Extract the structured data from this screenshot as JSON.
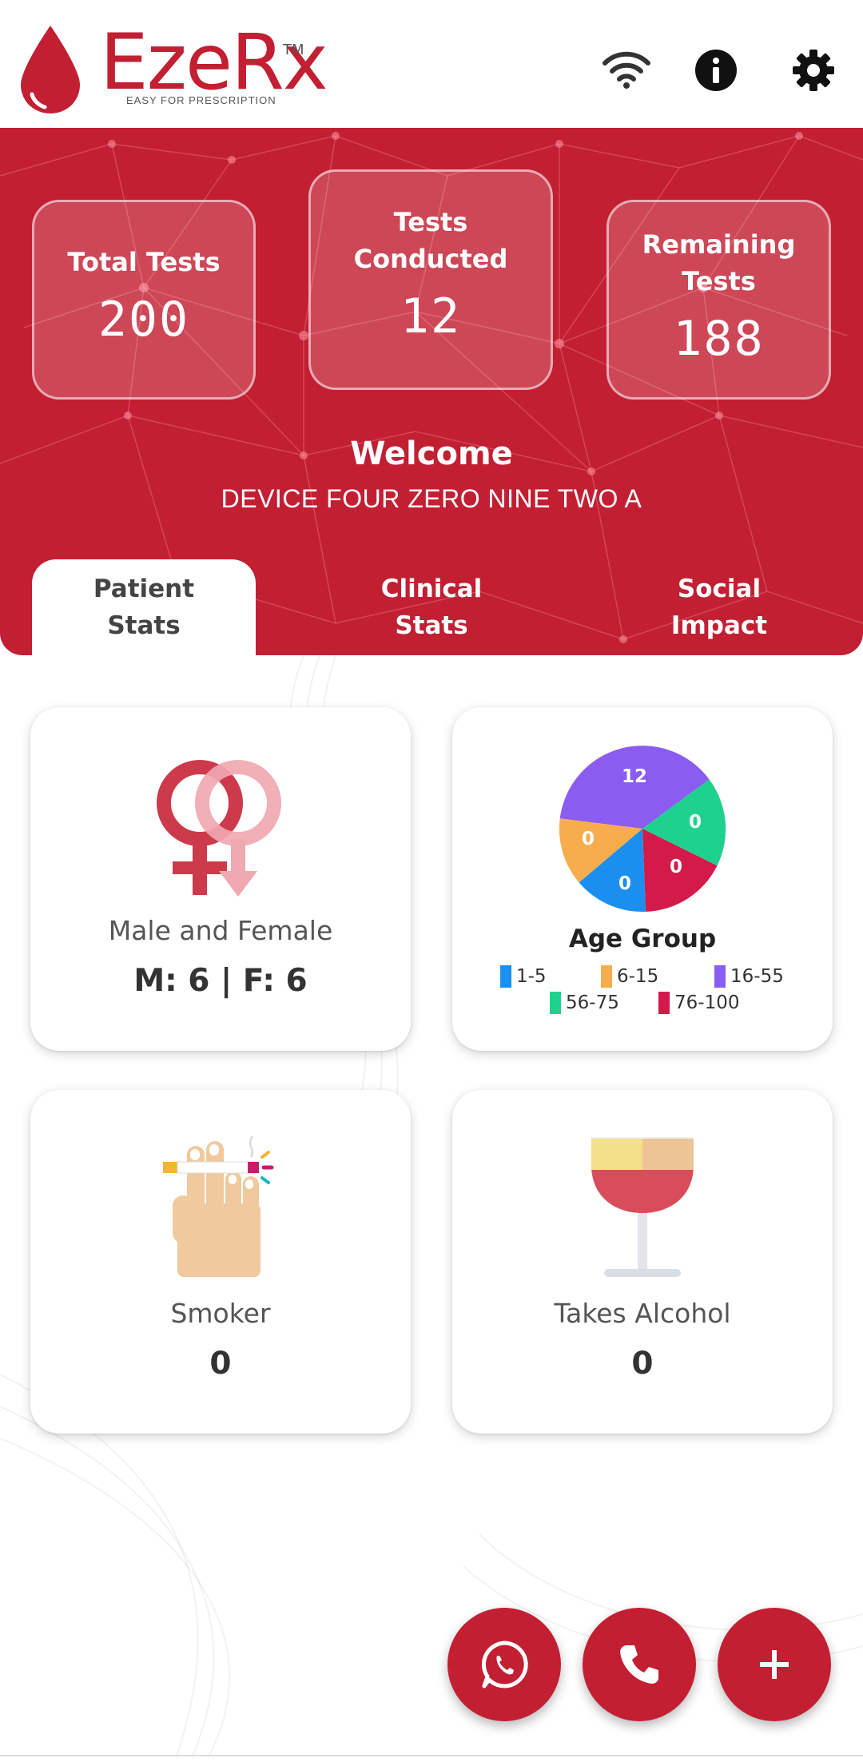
{
  "app": {
    "logo_text": "EzeRx",
    "logo_tm": "TM",
    "tagline": "EASY FOR PRESCRIPTION",
    "brand_color": "#c21f33"
  },
  "header_icons": [
    "wifi-icon",
    "info-icon",
    "settings-gear-icon"
  ],
  "stats": {
    "total": {
      "label": "Total Tests",
      "value": "200"
    },
    "conducted": {
      "label": "Tests Conducted",
      "value": "12"
    },
    "remaining": {
      "label": "Remaining Tests",
      "value": "188"
    }
  },
  "welcome": {
    "title": "Welcome",
    "device": "DEVICE FOUR ZERO NINE TWO A"
  },
  "tabs": [
    {
      "label": "Patient Stats",
      "active": true
    },
    {
      "label": "Clinical Stats",
      "active": false
    },
    {
      "label": "Social Impact",
      "active": false
    }
  ],
  "cards": {
    "gender": {
      "title": "Male and Female",
      "value": "M: 6 | F: 6",
      "icon": "gender-symbols-icon"
    },
    "age": {
      "title": "Age Group",
      "legend": [
        {
          "label": "1-5",
          "color": "#1a8ff0"
        },
        {
          "label": "6-15",
          "color": "#f7ad4e"
        },
        {
          "label": "16-55",
          "color": "#8b5cf0"
        },
        {
          "label": "56-75",
          "color": "#1fd18f"
        },
        {
          "label": "76-100",
          "color": "#d41a4a"
        }
      ]
    },
    "smoker": {
      "title": "Smoker",
      "value": "0",
      "icon": "cigarette-hand-icon"
    },
    "alcohol": {
      "title": "Takes Alcohol",
      "value": "0",
      "icon": "wine-glass-icon"
    }
  },
  "chart_data": {
    "type": "pie",
    "title": "Age Group",
    "categories": [
      "1-5",
      "6-15",
      "16-55",
      "56-75",
      "76-100"
    ],
    "values": [
      0,
      0,
      12,
      0,
      0
    ],
    "slice_labels": [
      "0",
      "0",
      "12",
      "0",
      "0"
    ],
    "colors": [
      "#1a8ff0",
      "#f7ad4e",
      "#8b5cf0",
      "#1fd18f",
      "#d41a4a"
    ],
    "legend_placement": "bottom"
  },
  "fabs": [
    "whatsapp-icon",
    "phone-icon",
    "plus-icon"
  ]
}
